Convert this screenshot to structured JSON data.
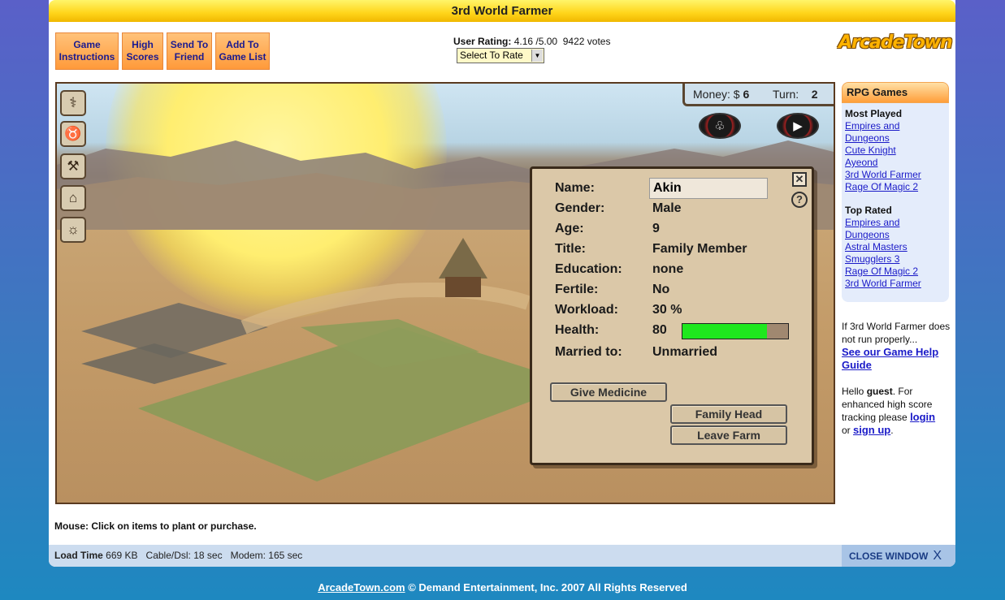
{
  "window": {
    "title": "3rd World Farmer"
  },
  "header_buttons": [
    {
      "label": "Game\nInstructions"
    },
    {
      "label": "High\nScores"
    },
    {
      "label": "Send To\nFriend"
    },
    {
      "label": "Add To\nGame List"
    }
  ],
  "rating": {
    "label": "User Rating:",
    "value": "4.16 /5.00",
    "votes": "9422 votes",
    "select_label": "Select To Rate"
  },
  "logo": {
    "text": "ArcadeTown"
  },
  "game": {
    "money_label": "Money: $",
    "money_value": "6",
    "turn_label": "Turn:",
    "turn_value": "2",
    "tools": [
      "hoe-tool-icon",
      "cow-icon",
      "hammer-icon",
      "hut-icon",
      "lightbulb-icon"
    ],
    "person": {
      "name_label": "Name:",
      "name_value": "Akin",
      "gender_label": "Gender:",
      "gender_value": "Male",
      "age_label": "Age:",
      "age_value": "9",
      "title_label": "Title:",
      "title_value": "Family Member",
      "education_label": "Education:",
      "education_value": "none",
      "fertile_label": "Fertile:",
      "fertile_value": "No",
      "workload_label": "Workload:",
      "workload_value": "30 %",
      "health_label": "Health:",
      "health_value": "80",
      "health_fraction": 0.8,
      "married_label": "Married to:",
      "married_value": "Unmarried"
    },
    "buttons": {
      "give_medicine": "Give Medicine",
      "family_head": "Family Head",
      "leave_farm": "Leave Farm"
    }
  },
  "mouse_message": {
    "label": "Mouse:",
    "text": "Click on items to plant or purchase."
  },
  "bottom": {
    "load_label": "Load Time",
    "load_value": "669 KB",
    "cable": "Cable/Dsl: 18 sec",
    "modem": "Modem: 165 sec",
    "close_label": "CLOSE WINDOW",
    "close_x": "X"
  },
  "sidebar": {
    "title": "RPG Games",
    "most_played_label": "Most Played",
    "most_played": [
      "Empires and Dungeons",
      "Cute Knight",
      "Ayeond",
      "3rd World Farmer",
      "Rage Of Magic 2"
    ],
    "top_rated_label": "Top Rated",
    "top_rated": [
      "Empires and Dungeons",
      "Astral Masters",
      "Smugglers 3",
      "Rage Of Magic 2",
      "3rd World Farmer"
    ]
  },
  "help": {
    "text1": "If 3rd World Farmer does not run properly...",
    "link1": "See our Game Help Guide",
    "hello": "Hello",
    "user": "guest",
    "text2": ". For enhanced high score tracking please",
    "login": "login",
    "or": "or",
    "signup": "sign up",
    "period": "."
  },
  "footer": {
    "link": "ArcadeTown.com",
    "text": "© Demand Entertainment, Inc. 2007 All Rights Reserved"
  }
}
